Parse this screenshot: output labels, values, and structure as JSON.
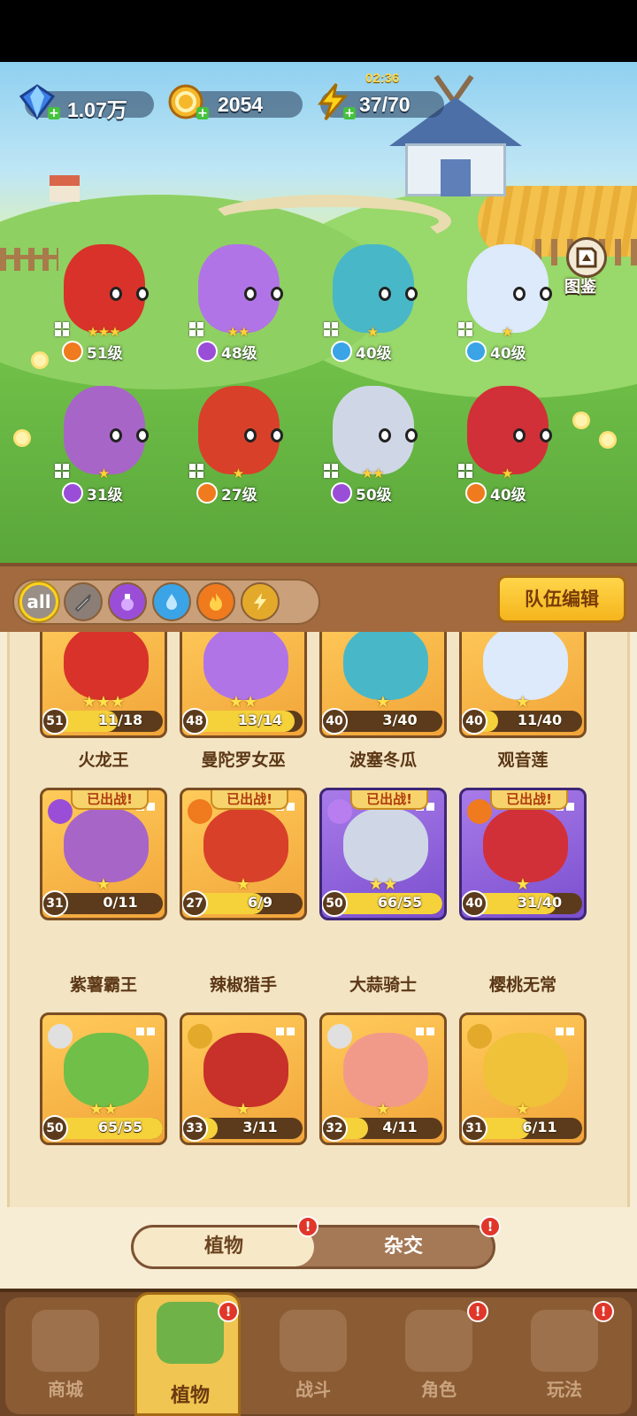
{
  "resources": {
    "gems": "1.07万",
    "coins": "2054",
    "energy": "37/70",
    "energy_timer": "02:36"
  },
  "atlas_label": "图鉴",
  "heroes": [
    {
      "level": "51级",
      "stars": "★★★",
      "element": "fire"
    },
    {
      "level": "48级",
      "stars": "★★",
      "element": "poison"
    },
    {
      "level": "40级",
      "stars": "★",
      "element": "water"
    },
    {
      "level": "40级",
      "stars": "★",
      "element": "water"
    },
    {
      "level": "31级",
      "stars": "★",
      "element": "poison"
    },
    {
      "level": "27级",
      "stars": "★",
      "element": "fire"
    },
    {
      "level": "50级",
      "stars": "★★",
      "element": "poison"
    },
    {
      "level": "40级",
      "stars": "★",
      "element": "fire"
    }
  ],
  "filters": [
    "all",
    "sword",
    "poison",
    "water",
    "fire",
    "lightning"
  ],
  "filter_all_label": "all",
  "team_edit_label": "队伍编辑",
  "cards": [
    {
      "name": "火龙王",
      "level": "51",
      "progress": "11/18",
      "stars": "★★★",
      "style": "gold"
    },
    {
      "name": "曼陀罗女巫",
      "level": "48",
      "progress": "13/14",
      "stars": "★★",
      "style": "gold"
    },
    {
      "name": "波塞冬瓜",
      "level": "40",
      "progress": "3/40",
      "stars": "★",
      "style": "gold"
    },
    {
      "name": "观音莲",
      "level": "40",
      "progress": "11/40",
      "stars": "★",
      "style": "gold"
    },
    {
      "name": "紫薯霸王",
      "level": "31",
      "progress": "0/11",
      "stars": "★",
      "style": "gold",
      "deployed": "已出战!"
    },
    {
      "name": "辣椒猎手",
      "level": "27",
      "progress": "6/9",
      "stars": "★",
      "style": "gold",
      "deployed": "已出战!"
    },
    {
      "name": "大蒜骑士",
      "level": "50",
      "progress": "66/55",
      "stars": "★★",
      "style": "purple",
      "deployed": "已出战!"
    },
    {
      "name": "樱桃无常",
      "level": "40",
      "progress": "31/40",
      "stars": "★",
      "style": "purple",
      "deployed": "已出战!"
    },
    {
      "name": "",
      "level": "50",
      "progress": "65/55",
      "stars": "★★",
      "style": "gold"
    },
    {
      "name": "",
      "level": "33",
      "progress": "3/11",
      "stars": "★",
      "style": "gold"
    },
    {
      "name": "",
      "level": "32",
      "progress": "4/11",
      "stars": "★",
      "style": "gold"
    },
    {
      "name": "",
      "level": "31",
      "progress": "6/11",
      "stars": "★",
      "style": "gold"
    }
  ],
  "segment": {
    "left": "植物",
    "right": "杂交"
  },
  "alert_mark": "!",
  "nav": [
    {
      "label": "商城"
    },
    {
      "label": "植物"
    },
    {
      "label": "战斗"
    },
    {
      "label": "角色"
    },
    {
      "label": "玩法"
    }
  ],
  "colors": {
    "fire": "#f07a1e",
    "poison": "#9a4ed8",
    "water": "#3aa4e6",
    "gold_card": "#f5b03e",
    "purple_card": "#8c5ad8"
  }
}
